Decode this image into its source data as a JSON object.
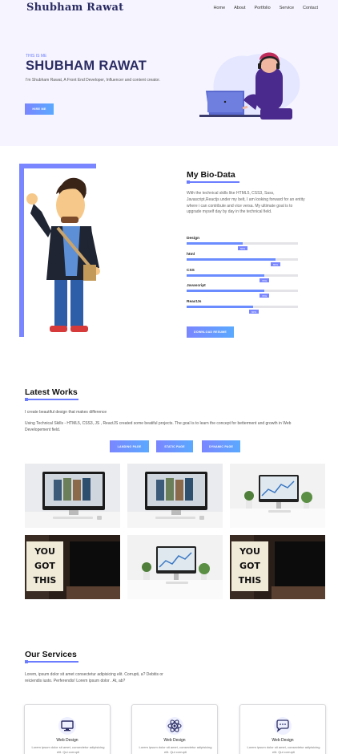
{
  "nav": {
    "brand": "Shubham Rawat",
    "links": [
      "Home",
      "About",
      "Portfolio",
      "Service",
      "Contact"
    ]
  },
  "hero": {
    "tag": "THIS IS ME",
    "name": "SHUBHAM RAWAT",
    "intro": "I'm Shubham Rawat, A Front End Developer, Influencer and content creator.",
    "button": "HIRE ME"
  },
  "bio": {
    "title": "My Bio-Data",
    "text": "With the technical skills like HTML5, CSS3, Sass, Javascript,Reactjs under my belt, I am looking forward for an entity where i can contribute and vice versa. My ultimate goal is to upgrade myself day by day in the technical field.",
    "skills": [
      {
        "name": "Design",
        "percent": 50,
        "label": "50%"
      },
      {
        "name": "html",
        "percent": 80,
        "label": "80%"
      },
      {
        "name": "CSS",
        "percent": 70,
        "label": "70%"
      },
      {
        "name": "Javascript",
        "percent": 70,
        "label": "70%"
      },
      {
        "name": "ReactJs",
        "percent": 60,
        "label": "60%"
      }
    ],
    "button": "DOWNLOAD RESUME"
  },
  "works": {
    "title": "Latest Works",
    "sub1": "I create beautiful design that makes difference",
    "sub2": "Using Technical Skills - HTML5, CSS3, JS , ReactJS created some beatiful projects. The goal is to learn the concept for betterment and growth in Web Developement field.",
    "filters": [
      "LANDING PAGE",
      "STATIC PAGE",
      "DYNAMIC PAGE"
    ],
    "tile_texts": [
      "YOU",
      "GOT",
      "THIS"
    ]
  },
  "services": {
    "title": "Our Services",
    "text": "Lorem, ipsum dolor sit amet consectetur adipisicing elit. Corrupti, a? Debitis or reiciendis iusto. Perferendis! Lorem ipsum dolor . At, ab?",
    "cards": [
      {
        "title": "Web Design",
        "desc": "Lorem ipsum dolor sit amet, consectetur adipisicing elit. Qui corrupti"
      },
      {
        "title": "Web Design",
        "desc": "Lorem ipsum dolor sit amet, consectetur adipisicing elit. Qui corrupti"
      },
      {
        "title": "Web Design",
        "desc": "Lorem ipsum dolor sit amet, consectetur adipisicing elit. Qui corrupti"
      }
    ]
  },
  "colors": {
    "accent": "#6b7cff",
    "navy": "#2b2c64",
    "hero_bg": "#f6f5ff"
  }
}
